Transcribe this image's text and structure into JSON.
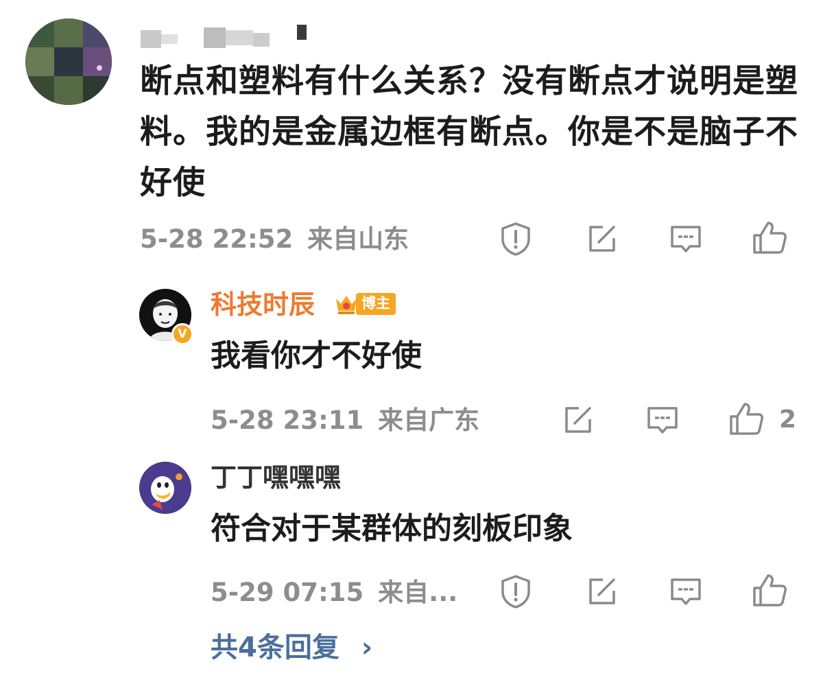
{
  "comment": {
    "text": "断点和塑料有什么关系？没有断点才说明是塑料。我的是金属边框有断点。你是不是脑子不好使",
    "time": "5-28 22:52",
    "location": "来自山东"
  },
  "replies": [
    {
      "username": "科技时辰",
      "badge": "博主",
      "verified": "V",
      "text": "我看你才不好使",
      "time": "5-28 23:11",
      "location": "来自广东",
      "like_count": "2"
    },
    {
      "username": "丁丁嘿嘿嘿",
      "text": "符合对于某群体的刻板印象",
      "time": "5-29 07:15",
      "location": "来自..."
    }
  ],
  "more_replies": "共4条回复",
  "more_arrow": "›",
  "icons": {
    "report": "shield-exclamation-icon",
    "share": "edit-share-icon",
    "comment": "comment-bubble-icon",
    "like": "thumbs-up-icon"
  },
  "colors": {
    "username": "#ee7a2f",
    "link": "#4a6f9c",
    "meta": "#8d8d8d",
    "badge": "#f5a623"
  }
}
